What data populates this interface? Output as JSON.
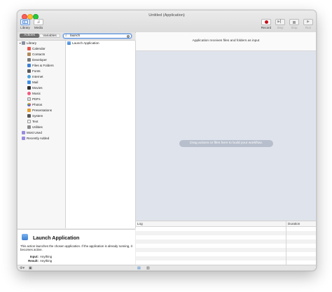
{
  "window": {
    "title": "Untitled (Application)"
  },
  "toolbar": {
    "library_label": "Library",
    "media_label": "Media",
    "record_label": "Record",
    "step_label": "Step",
    "stop_label": "Stop",
    "run_label": "Run"
  },
  "tabs": {
    "actions": "Actions",
    "variables": "Variables"
  },
  "search": {
    "value": "launch"
  },
  "library": {
    "root": "Library",
    "items": [
      "Calendar",
      "Contacts",
      "Developer",
      "Files & Folders",
      "Fonts",
      "Internet",
      "Mail",
      "Movies",
      "Music",
      "PDFs",
      "Photos",
      "Presentations",
      "System",
      "Text",
      "Utilities"
    ],
    "extras": [
      "Most Used",
      "Recently Added"
    ]
  },
  "actions_list": {
    "items": [
      "Launch Application"
    ]
  },
  "description": {
    "title": "Launch Application",
    "text": "This action launches the chosen application. If the application is already running, it becomes active.",
    "input_label": "Input:",
    "input_value": "Anything",
    "result_label": "Result:",
    "result_value": "Anything"
  },
  "workflow": {
    "receives_text": "Application receives files and folders as input",
    "placeholder": "Drag actions or files here to build your workflow."
  },
  "log": {
    "col_log": "Log",
    "col_duration": "Duration"
  },
  "colors": {
    "record": "#d0021b",
    "accent": "#5b93e0",
    "dropzone": "#dfe3ec"
  }
}
